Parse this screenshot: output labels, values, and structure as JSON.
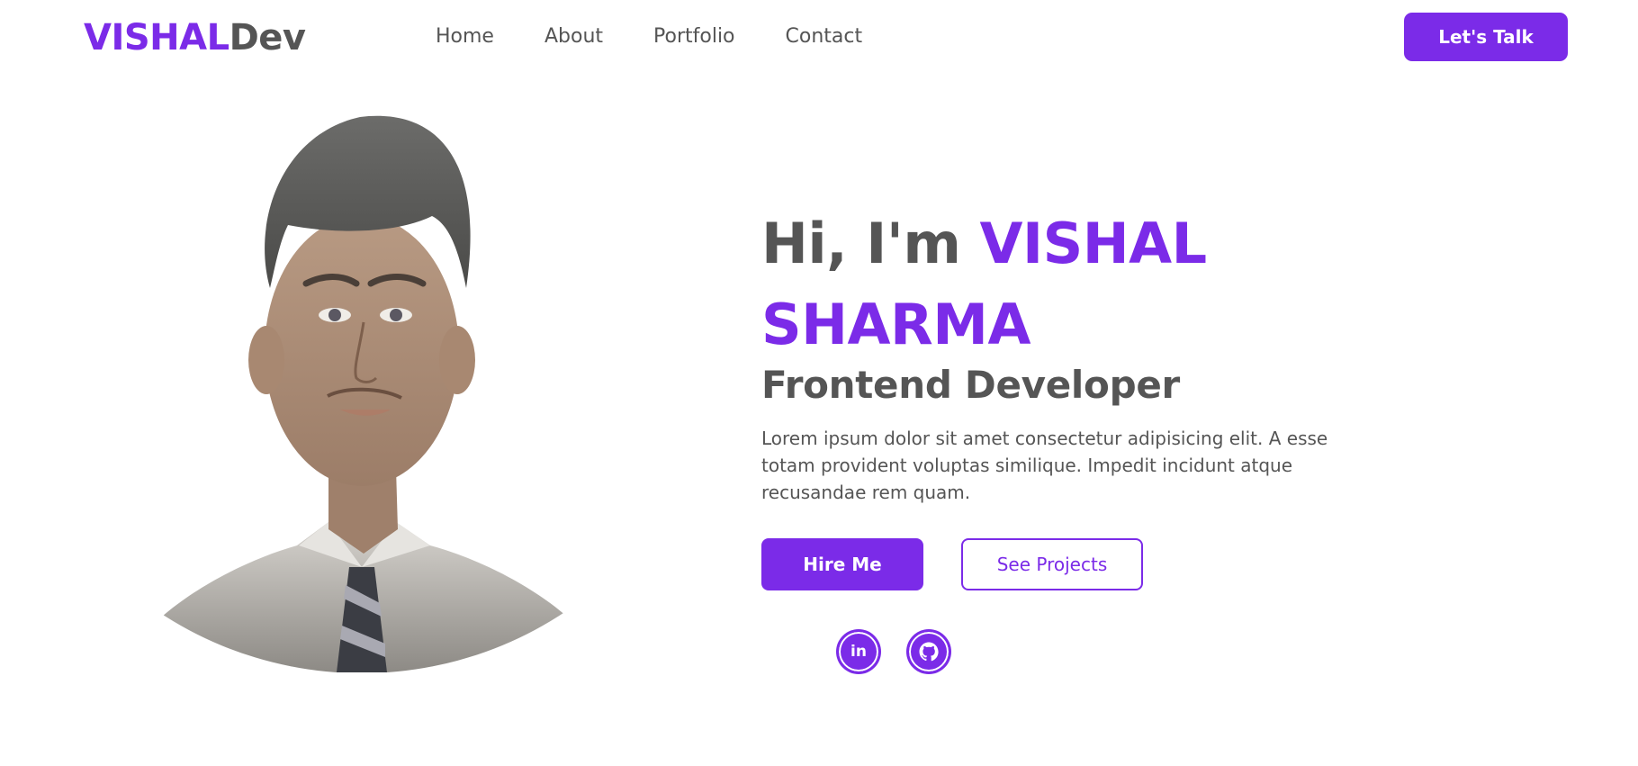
{
  "logo": {
    "accent": "VISHAL",
    "rest": "Dev"
  },
  "nav": {
    "links": [
      "Home",
      "About",
      "Portfolio",
      "Contact"
    ],
    "cta_label": "Let's Talk"
  },
  "hero": {
    "greeting_prefix": "Hi, I'm ",
    "name_line1": "VISHAL",
    "name_line2": "SHARMA",
    "role": "Frontend Developer",
    "bio": "Lorem ipsum dolor sit amet consectetur adipisicing elit. A esse totam provident voluptas similique. Impedit incidunt atque recusandae rem quam.",
    "hire_label": "Hire Me",
    "projects_label": "See Projects",
    "linkedin_glyph": "in"
  },
  "colors": {
    "accent": "#7b2be8",
    "text": "#555555",
    "background": "#ffffff"
  },
  "icons": [
    "linkedin-icon",
    "github-icon"
  ]
}
